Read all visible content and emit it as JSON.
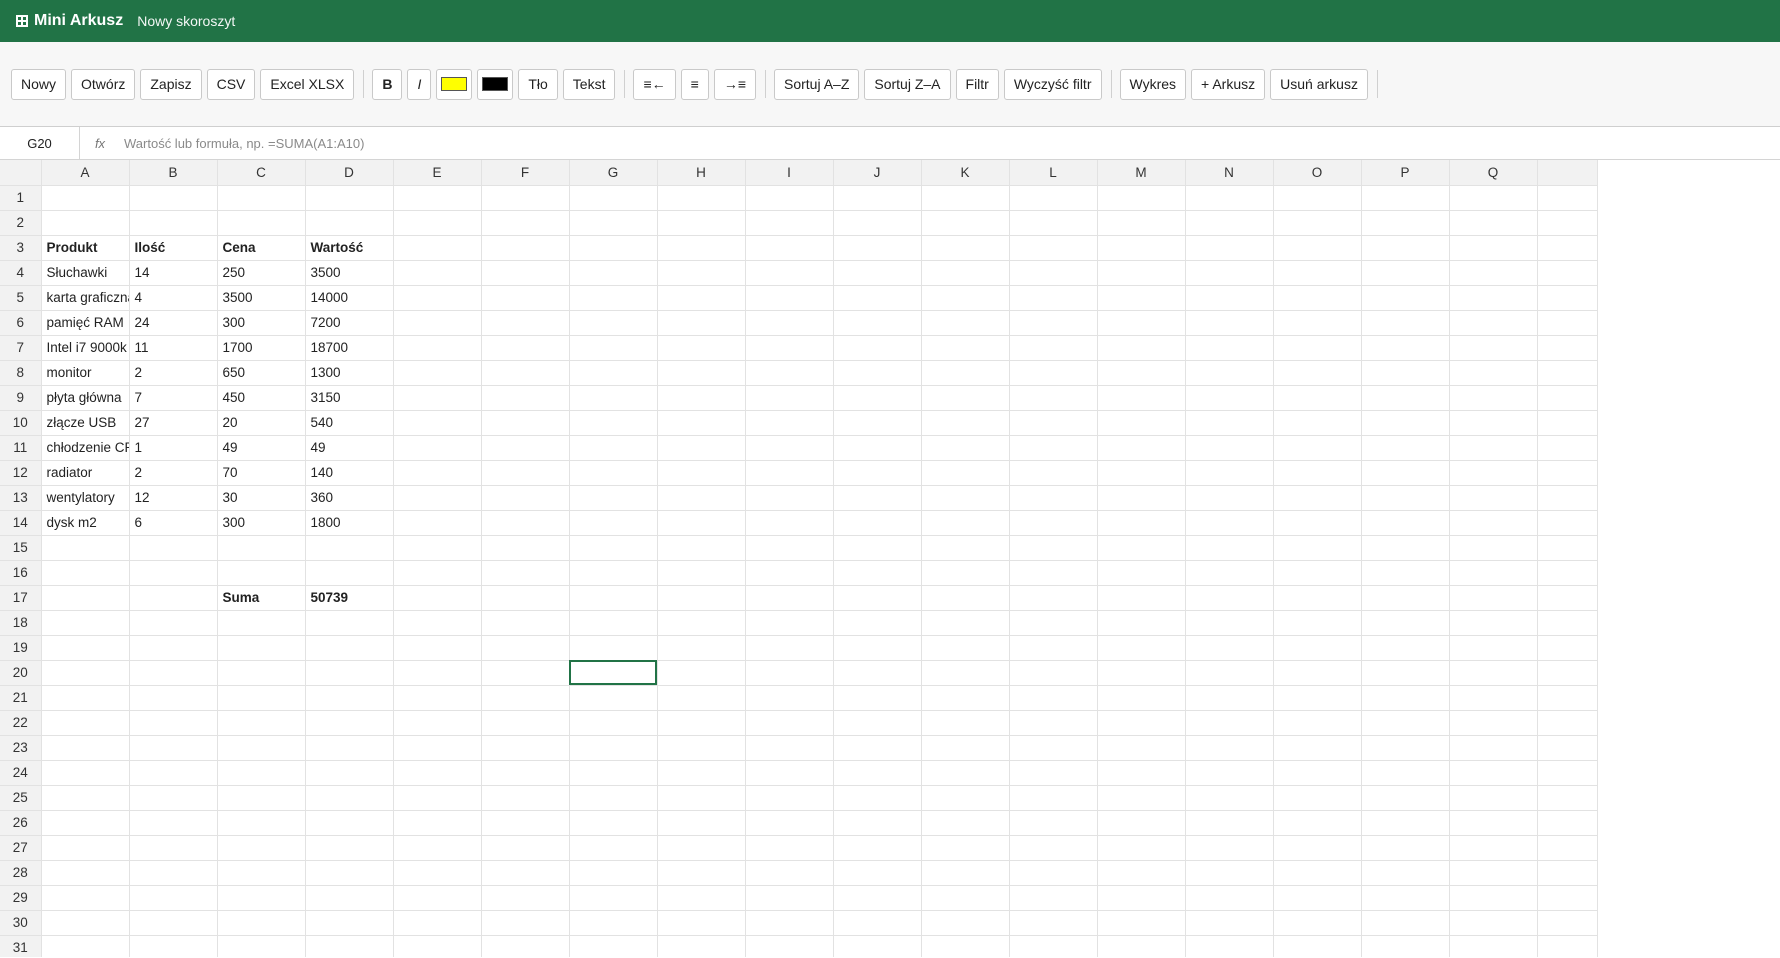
{
  "app": {
    "name": "Mini Arkusz",
    "document": "Nowy skoroszyt"
  },
  "toolbar": {
    "file_buttons": [
      "Nowy",
      "Otwórz",
      "Zapisz",
      "CSV",
      "Excel XLSX"
    ],
    "bold_label": "B",
    "italic_label": "I",
    "fill_color": "#ffff00",
    "text_color": "#000000",
    "bg_label": "Tło",
    "text_label": "Tekst",
    "align_left_label": "≡←",
    "align_center_label": "≡",
    "align_right_label": "→≡",
    "sort_asc_label": "Sortuj A–Z",
    "sort_desc_label": "Sortuj Z–A",
    "filter_label": "Filtr",
    "clear_filter_label": "Wyczyść filtr",
    "chart_label": "Wykres",
    "add_sheet_label": "+ Arkusz",
    "delete_sheet_label": "Usuń arkusz"
  },
  "formula_bar": {
    "cell_ref": "G20",
    "fx_label": "fx",
    "value": "",
    "placeholder": "Wartość lub formuła, np. =SUMA(A1:A10)"
  },
  "grid": {
    "columns": [
      "A",
      "B",
      "C",
      "D",
      "E",
      "F",
      "G",
      "H",
      "I",
      "J",
      "K",
      "L",
      "M",
      "N",
      "O",
      "P",
      "Q"
    ],
    "row_count": 31,
    "selected_cell": "G20",
    "cells": {
      "A3": "Produkt",
      "B3": "Ilość",
      "C3": "Cena",
      "D3": "Wartość",
      "A4": "Słuchawki",
      "B4": "14",
      "C4": "250",
      "D4": "3500",
      "A5": "karta graficzna",
      "B5": "4",
      "C5": "3500",
      "D5": "14000",
      "A6": "pamięć RAM",
      "B6": "24",
      "C6": "300",
      "D6": "7200",
      "A7": "Intel i7 9000k",
      "B7": "11",
      "C7": "1700",
      "D7": "18700",
      "A8": "monitor",
      "B8": "2",
      "C8": "650",
      "D8": "1300",
      "A9": "płyta główna",
      "B9": "7",
      "C9": "450",
      "D9": "3150",
      "A10": "złącze USB",
      "B10": "27",
      "C10": "20",
      "D10": "540",
      "A11": "chłodzenie CPU",
      "B11": "1",
      "C11": "49",
      "D11": "49",
      "A12": "radiator",
      "B12": "2",
      "C12": "70",
      "D12": "140",
      "A13": "wentylatory",
      "B13": "12",
      "C13": "30",
      "D13": "360",
      "A14": "dysk m2",
      "B14": "6",
      "C14": "300",
      "D14": "1800",
      "C17": "Suma",
      "D17": "50739"
    },
    "bold_cells": [
      "A3",
      "B3",
      "C3",
      "D3",
      "C17",
      "D17"
    ]
  }
}
